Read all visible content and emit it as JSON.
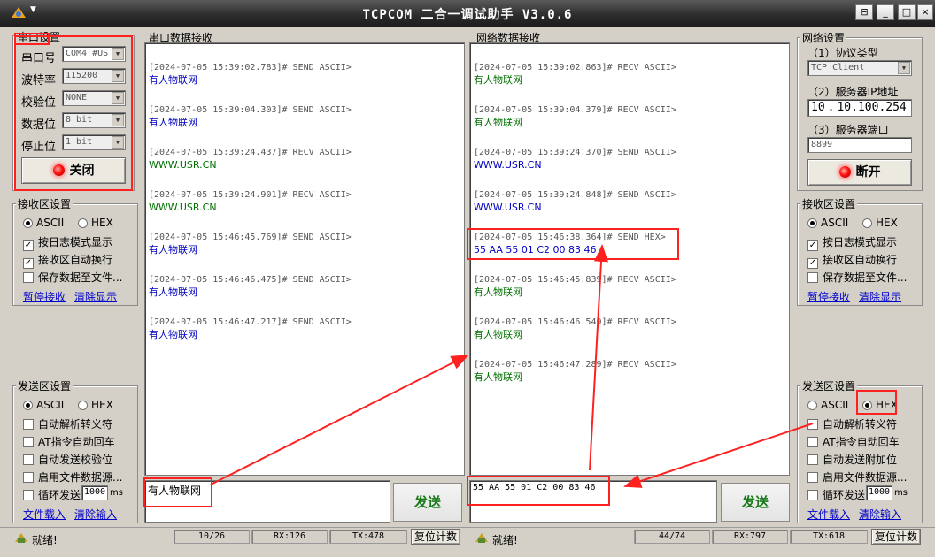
{
  "window": {
    "title": "TCPCOM  二合一调试助手  V3.0.6",
    "minimize": "_",
    "maximize": "□",
    "close": "×",
    "pin": "⊟"
  },
  "serial": {
    "title": "串口设置",
    "port_label": "串口号",
    "port_value": "COM4 #US",
    "baud_label": "波特率",
    "baud_value": "115200",
    "parity_label": "校验位",
    "parity_value": "NONE",
    "databits_label": "数据位",
    "databits_value": "8 bit",
    "stopbits_label": "停止位",
    "stopbits_value": "1 bit",
    "close_btn": "关闭"
  },
  "left_recv": {
    "title": "接收区设置",
    "ascii": "ASCII",
    "hex": "HEX",
    "log_mode": "按日志模式显示",
    "auto_wrap": "接收区自动换行",
    "save_file": "保存数据至文件...",
    "pause": "暂停接收",
    "clear": "清除显示"
  },
  "left_send": {
    "title": "发送区设置",
    "ascii": "ASCII",
    "hex": "HEX",
    "auto_escape": "自动解析转义符",
    "at_return": "AT指令自动回车",
    "auto_checksum": "自动发送校验位",
    "file_source": "启用文件数据源...",
    "loop_send": "循环发送",
    "interval": "1000",
    "ms": "ms",
    "load_file": "文件载入",
    "clear_input": "清除输入"
  },
  "serial_recv": {
    "title": "串口数据接收",
    "entries": [
      {
        "hdr": "[2024-07-05 15:39:02.783]# SEND ASCII>",
        "msg": "有人物联网",
        "color": "blue"
      },
      {
        "hdr": "[2024-07-05 15:39:04.303]# SEND ASCII>",
        "msg": "有人物联网",
        "color": "blue"
      },
      {
        "hdr": "[2024-07-05 15:39:24.437]# RECV ASCII>",
        "msg": "WWW.USR.CN",
        "color": "green"
      },
      {
        "hdr": "[2024-07-05 15:39:24.901]# RECV ASCII>",
        "msg": "WWW.USR.CN",
        "color": "green"
      },
      {
        "hdr": "[2024-07-05 15:46:45.769]# SEND ASCII>",
        "msg": "有人物联网",
        "color": "blue"
      },
      {
        "hdr": "[2024-07-05 15:46:46.475]# SEND ASCII>",
        "msg": "有人物联网",
        "color": "blue"
      },
      {
        "hdr": "[2024-07-05 15:46:47.217]# SEND ASCII>",
        "msg": "有人物联网",
        "color": "blue"
      }
    ]
  },
  "net_recv": {
    "title": "网络数据接收",
    "entries": [
      {
        "hdr": "[2024-07-05 15:39:02.863]# RECV ASCII>",
        "msg": "有人物联网",
        "color": "green"
      },
      {
        "hdr": "[2024-07-05 15:39:04.379]# RECV ASCII>",
        "msg": "有人物联网",
        "color": "green"
      },
      {
        "hdr": "[2024-07-05 15:39:24.370]# SEND ASCII>",
        "msg": "WWW.USR.CN",
        "color": "blue"
      },
      {
        "hdr": "[2024-07-05 15:39:24.848]# SEND ASCII>",
        "msg": "WWW.USR.CN",
        "color": "blue"
      },
      {
        "hdr": "[2024-07-05 15:46:38.364]# SEND HEX>",
        "msg": "55 AA 55 01 C2 00 83 46",
        "color": "blue"
      },
      {
        "hdr": "[2024-07-05 15:46:45.839]# RECV ASCII>",
        "msg": "有人物联网",
        "color": "green"
      },
      {
        "hdr": "[2024-07-05 15:46:46.549]# RECV ASCII>",
        "msg": "有人物联网",
        "color": "green"
      },
      {
        "hdr": "[2024-07-05 15:46:47.289]# RECV ASCII>",
        "msg": "有人物联网",
        "color": "green"
      }
    ]
  },
  "serial_send": {
    "input": "有人物联网",
    "send_btn": "发送"
  },
  "net_send": {
    "input": "55 AA 55 01 C2 00 83 46",
    "send_btn": "发送"
  },
  "network": {
    "title": "网络设置",
    "proto_label": "（1）协议类型",
    "proto_value": "TCP Client",
    "server_ip_label": "（2）服务器IP地址",
    "ip": [
      "10",
      ".",
      "10",
      ".",
      "100",
      ".",
      "254"
    ],
    "port_label": "（3）服务器端口",
    "port_value": "8899",
    "disconnect_btn": "断开"
  },
  "right_recv": {
    "title": "接收区设置",
    "ascii": "ASCII",
    "hex": "HEX",
    "log_mode": "按日志模式显示",
    "auto_wrap": "接收区自动换行",
    "save_file": "保存数据至文件...",
    "pause": "暂停接收",
    "clear": "清除显示"
  },
  "right_send": {
    "title": "发送区设置",
    "ascii": "ASCII",
    "hex": "HEX",
    "auto_escape": "自动解析转义符",
    "at_return": "AT指令自动回车",
    "auto_append": "自动发送附加位",
    "file_source": "启用文件数据源...",
    "loop_send": "循环发送",
    "interval": "1000",
    "ms": "ms",
    "load_file": "文件载入",
    "clear_input": "清除输入"
  },
  "status_left": {
    "ready": "就绪!",
    "count": "10/26",
    "rx": "RX:126",
    "tx": "TX:478",
    "reset": "复位计数"
  },
  "status_right": {
    "ready": "就绪!",
    "count": "44/74",
    "rx": "RX:797",
    "tx": "TX:618",
    "reset": "复位计数"
  },
  "colors": {
    "annotation": "#ff2020",
    "send": "#0000c0",
    "recv": "#007000",
    "send_btn": "#1a7a1a"
  }
}
